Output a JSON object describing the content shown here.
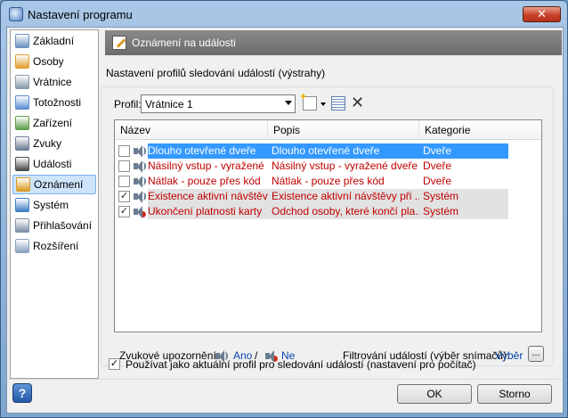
{
  "window": {
    "title": "Nastavení programu",
    "close_label": "✕"
  },
  "sidebar": {
    "items": [
      {
        "label": "Základní",
        "icon": "settings-icon",
        "color": "#6a8fbf"
      },
      {
        "label": "Osoby",
        "icon": "people-icon",
        "color": "#e0a030"
      },
      {
        "label": "Vrátnice",
        "icon": "gatehouse-icon",
        "color": "#8a9aa8"
      },
      {
        "label": "Totožnosti",
        "icon": "id-card-icon",
        "color": "#5b8fd0"
      },
      {
        "label": "Zařízení",
        "icon": "device-icon",
        "color": "#5f9e4a"
      },
      {
        "label": "Zvuky",
        "icon": "speaker-icon",
        "color": "#6b7d92"
      },
      {
        "label": "Události",
        "icon": "events-icon",
        "color": "#4a4a4a"
      },
      {
        "label": "Oznámení",
        "icon": "notification-icon",
        "color": "#d99a21"
      },
      {
        "label": "Systém",
        "icon": "system-icon",
        "color": "#3f7fc4"
      },
      {
        "label": "Přihlašování",
        "icon": "login-icon",
        "color": "#7b8fa8"
      },
      {
        "label": "Rozšíření",
        "icon": "extensions-icon",
        "color": "#8aa0bf"
      }
    ],
    "selected_index": 7
  },
  "header": {
    "title": "Oznámení na události"
  },
  "subtitle": "Nastavení profilů sledování událostí (výstrahy)",
  "profile": {
    "label": "Profil:",
    "value": "Vrátnice 1"
  },
  "table": {
    "columns": [
      "Název",
      "Popis",
      "Kategorie"
    ],
    "rows": [
      {
        "checked": false,
        "sound": "on",
        "name": "Dlouho otevřené dveře",
        "description": "Dlouho otevřené dveře",
        "category": "Dveře",
        "state": "selected"
      },
      {
        "checked": false,
        "sound": "on",
        "name": "Násilný vstup - vyražené ...",
        "description": "Násilný vstup - vyražené dveře",
        "category": "Dveře",
        "state": "normal"
      },
      {
        "checked": false,
        "sound": "on",
        "name": "Nátlak - pouze přes kód",
        "description": "Nátlak - pouze přes kód",
        "category": "Dveře",
        "state": "normal"
      },
      {
        "checked": true,
        "sound": "on",
        "name": "Existence aktivní návštěvy",
        "description": "Existence aktivní návštěvy při ...",
        "category": "Systém",
        "state": "gray"
      },
      {
        "checked": true,
        "sound": "off",
        "name": "Ukončení platnosti karty",
        "description": "Odchod osoby, které končí pla...",
        "category": "Systém",
        "state": "gray"
      }
    ]
  },
  "sound_notice": {
    "label": "Zvukové upozornění:",
    "yes": "Ano",
    "separator": "/",
    "no": "Ne"
  },
  "filter": {
    "label": "Filtrování událostí (výběr snímačů):",
    "link": "Výběr",
    "button": "..."
  },
  "usage_checkbox": {
    "checked": true,
    "label": "Používat jako aktuální profil pro sledování událostí (nastavení pro počítač)"
  },
  "buttons": {
    "help": "?",
    "ok": "OK",
    "cancel": "Storno"
  },
  "colors": {
    "selection": "#3399ff",
    "alert_text": "#c00000",
    "link": "#0645ad"
  }
}
